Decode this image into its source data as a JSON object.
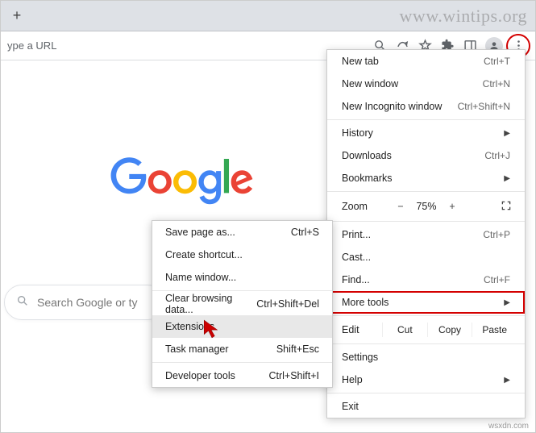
{
  "watermark": "www.wintips.org",
  "footmark": "wsxdn.com",
  "tabbar": {
    "newtab_tooltip": "+"
  },
  "toolbar": {
    "url_placeholder": "ype a URL"
  },
  "search": {
    "placeholder": "Search Google or ty"
  },
  "menu": {
    "new_tab": "New tab",
    "new_tab_sc": "Ctrl+T",
    "new_window": "New window",
    "new_window_sc": "Ctrl+N",
    "new_incognito": "New Incognito window",
    "new_incognito_sc": "Ctrl+Shift+N",
    "history": "History",
    "downloads": "Downloads",
    "downloads_sc": "Ctrl+J",
    "bookmarks": "Bookmarks",
    "zoom_label": "Zoom",
    "zoom_value": "75%",
    "print": "Print...",
    "print_sc": "Ctrl+P",
    "cast": "Cast...",
    "find": "Find...",
    "find_sc": "Ctrl+F",
    "more_tools": "More tools",
    "edit": "Edit",
    "cut": "Cut",
    "copy": "Copy",
    "paste": "Paste",
    "settings": "Settings",
    "help": "Help",
    "exit": "Exit"
  },
  "submenu": {
    "save_page": "Save page as...",
    "save_page_sc": "Ctrl+S",
    "create_shortcut": "Create shortcut...",
    "name_window": "Name window...",
    "clear_data": "Clear browsing data...",
    "clear_data_sc": "Ctrl+Shift+Del",
    "extensions": "Extensions",
    "task_manager": "Task manager",
    "task_manager_sc": "Shift+Esc",
    "dev_tools": "Developer tools",
    "dev_tools_sc": "Ctrl+Shift+I"
  }
}
